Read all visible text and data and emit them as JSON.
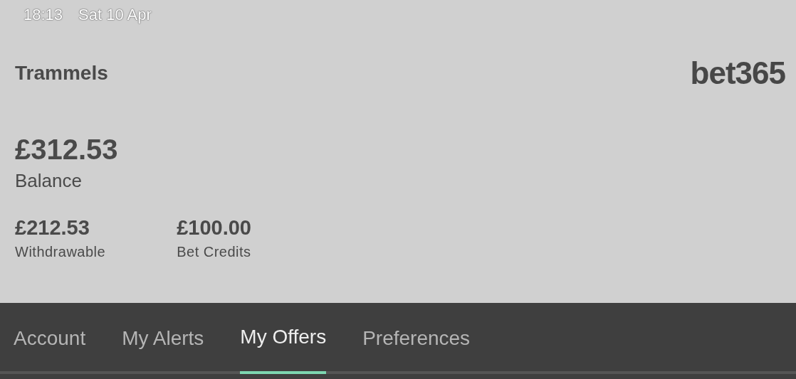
{
  "status_bar": {
    "time": "18:13",
    "date": "Sat 10 Apr"
  },
  "header": {
    "username": "Trammels",
    "logo": "bet365"
  },
  "balance": {
    "amount": "£312.53",
    "label": "Balance"
  },
  "sub_balances": [
    {
      "amount": "£212.53",
      "label": "Withdrawable"
    },
    {
      "amount": "£100.00",
      "label": "Bet Credits"
    }
  ],
  "tabs": [
    {
      "label": "Account",
      "selected": false
    },
    {
      "label": "My Alerts",
      "selected": false
    },
    {
      "label": "My Offers",
      "selected": true
    },
    {
      "label": "Preferences",
      "selected": false
    }
  ]
}
